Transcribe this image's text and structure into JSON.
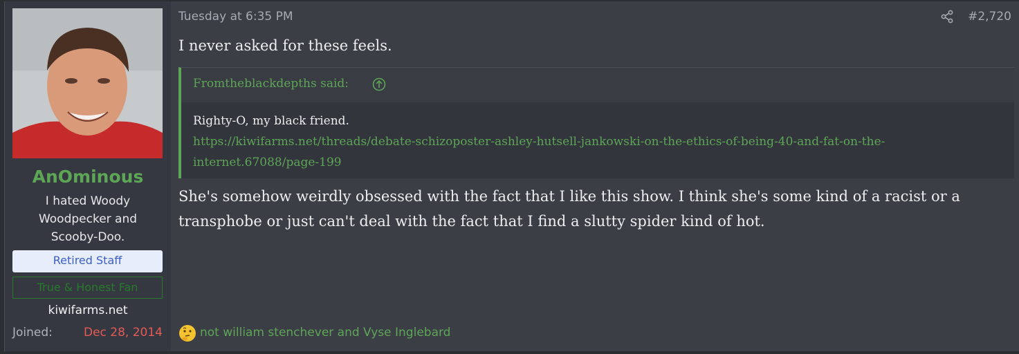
{
  "user": {
    "username": "AnOminous",
    "title": "I hated Woody Woodpecker and Scooby-Doo.",
    "banner_retired": "Retired Staff",
    "banner_fan": "True & Honest Fan",
    "site": "kiwifarms.net",
    "joined_label": "Joined:",
    "joined_date": "Dec 28, 2014"
  },
  "post": {
    "timestamp": "Tuesday at 6:35 PM",
    "number": "#2,720",
    "first_line": "I never asked for these feels.",
    "quote": {
      "author": "Fromtheblackdepths said:",
      "text": "Righty-O, my black friend.",
      "link": "https://kiwifarms.net/threads/debate-schizoposter-ashley-hutsell-jankowski-on-the-ethics-of-being-40-and-fat-on-the-internet.67088/page-199"
    },
    "body": "She's somehow weirdly obsessed with the fact that I like this show. I think she's some kind of a racist or a transphobe or just can't deal with the fact that I find a slutty spider kind of hot.",
    "reactions": "not william stenchever and Vyse Inglebard"
  },
  "colors": {
    "accent_green": "#5ea557",
    "joined_red": "#e45b56",
    "retired_blue": "#3b5fc4"
  },
  "icons": [
    "share-icon",
    "arrow-up-circle-icon",
    "thinking-face-icon"
  ]
}
